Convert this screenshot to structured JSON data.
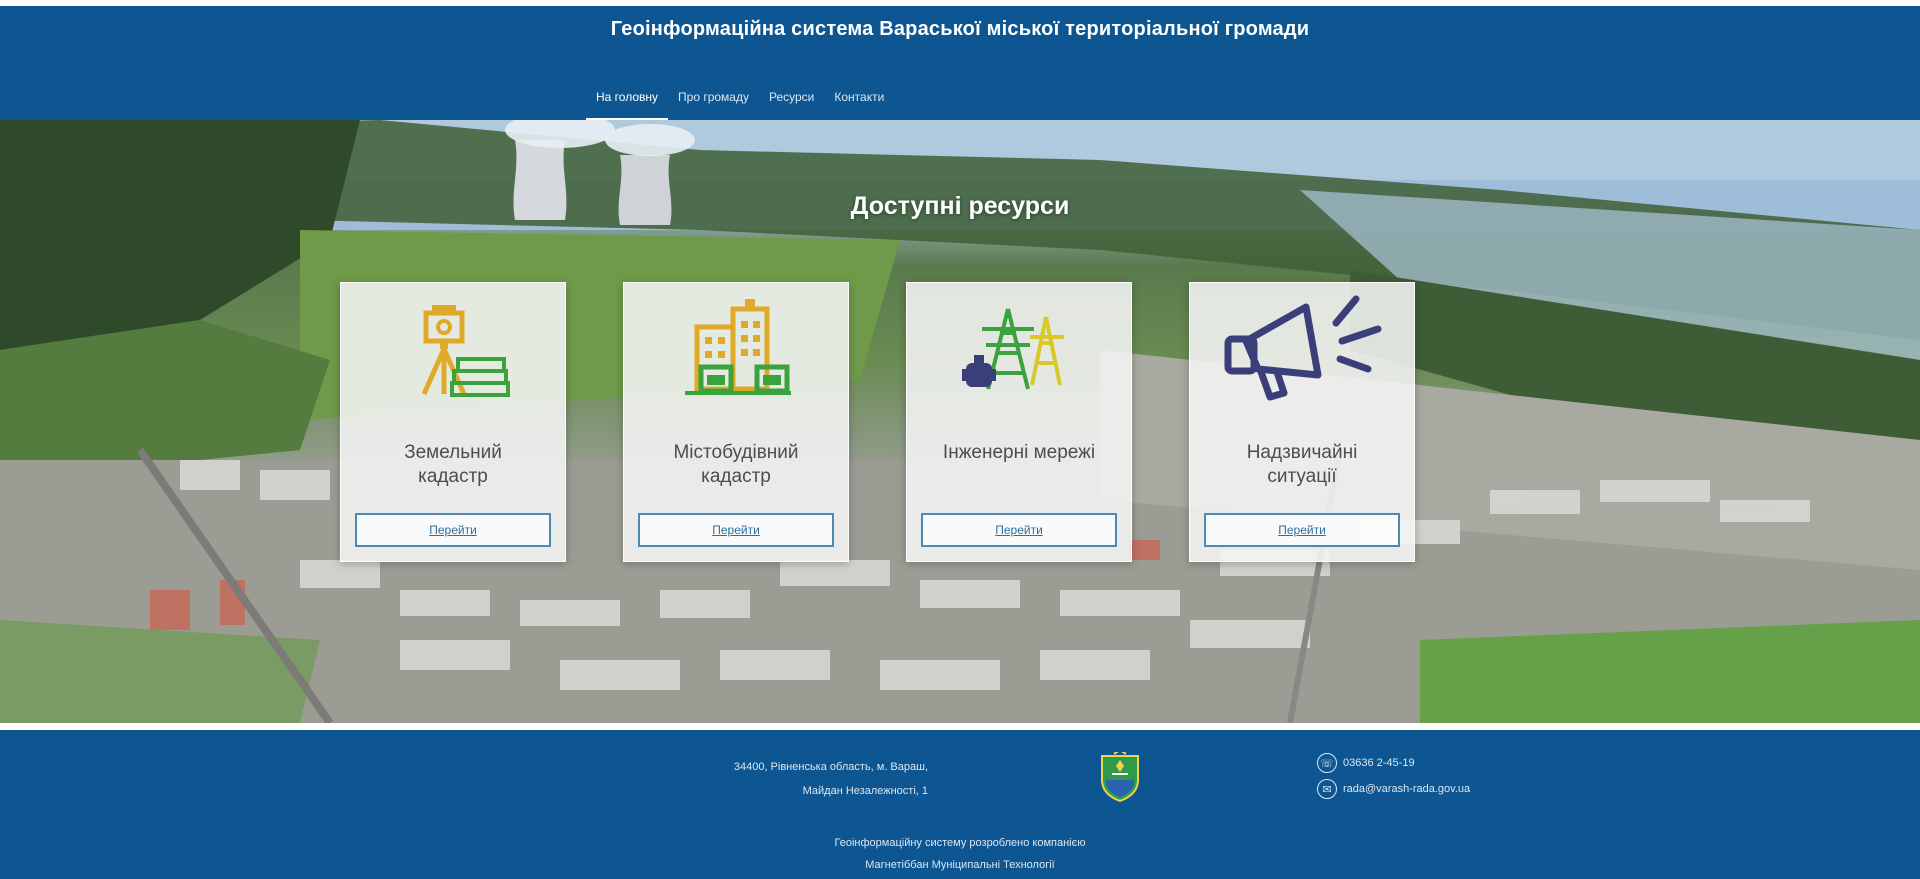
{
  "header": {
    "title": "Геоінформаційна система Вараської міської територіальної громади",
    "nav": [
      {
        "label": "На головну",
        "active": true
      },
      {
        "label": "Про громаду"
      },
      {
        "label": "Ресурси"
      },
      {
        "label": "Контакти"
      }
    ]
  },
  "hero": {
    "title": "Доступні ресурси",
    "cards": [
      {
        "title": "Земельний\nкадастр",
        "icon": "surveying-theodolite-icon",
        "button": "Перейти"
      },
      {
        "title": "Містобудівний\nкадастр",
        "icon": "city-buildings-icon",
        "button": "Перейти"
      },
      {
        "title": "Інженерні мережі",
        "icon": "power-lines-icon",
        "button": "Перейти"
      },
      {
        "title": "Надзвичайні\nситуації",
        "icon": "megaphone-icon",
        "button": "Перейти"
      }
    ]
  },
  "footer": {
    "address_line1": "34400, Рівненська область, м. Вараш,",
    "address_line2": "Майдан Незалежності, 1",
    "phone": "03636 2-45-19",
    "email": "rada@varash-rada.gov.ua",
    "dev_line1": "Геоінформаційну систему розроблено компанією",
    "dev_line2": "Магнетіббан Муніципальні Технології"
  },
  "colors": {
    "primary": "#0d5692",
    "card_button_border": "#4c8ab5",
    "icon_gold": "#e0a92a",
    "icon_green": "#3aa33d",
    "icon_navy": "#3a3f7a"
  }
}
